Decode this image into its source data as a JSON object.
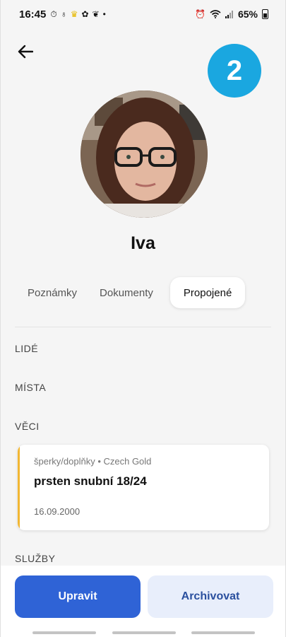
{
  "status_bar": {
    "time": "16:45",
    "notification_icons": [
      "timer-icon",
      "bulb-icon",
      "crown-icon",
      "flower-icon",
      "leaf-icon",
      "dot-icon"
    ],
    "battery": "65%",
    "right_icons": [
      "alarm-icon",
      "wifi-icon",
      "signal-icon",
      "battery-icon"
    ]
  },
  "header": {
    "back_icon": "arrow-left-icon",
    "step_badge": "2"
  },
  "profile": {
    "name": "Iva"
  },
  "tabs": [
    {
      "label": "Poznámky",
      "active": false
    },
    {
      "label": "Dokumenty",
      "active": false
    },
    {
      "label": "Propojené",
      "active": true
    }
  ],
  "sections": {
    "people": "LIDÉ",
    "places": "MÍSTA",
    "things": "VĚCI",
    "services": "SLUŽBY"
  },
  "things_items": [
    {
      "meta": "šperky/doplňky • Czech Gold",
      "title": "prsten snubní 18/24",
      "date": "16.09.2000",
      "accent_color": "#f2b733"
    }
  ],
  "actions": {
    "edit_label": "Upravit",
    "archive_label": "Archivovat"
  },
  "colors": {
    "primary": "#2f63d6",
    "badge": "#1aa7e0",
    "accent": "#f2b733"
  }
}
